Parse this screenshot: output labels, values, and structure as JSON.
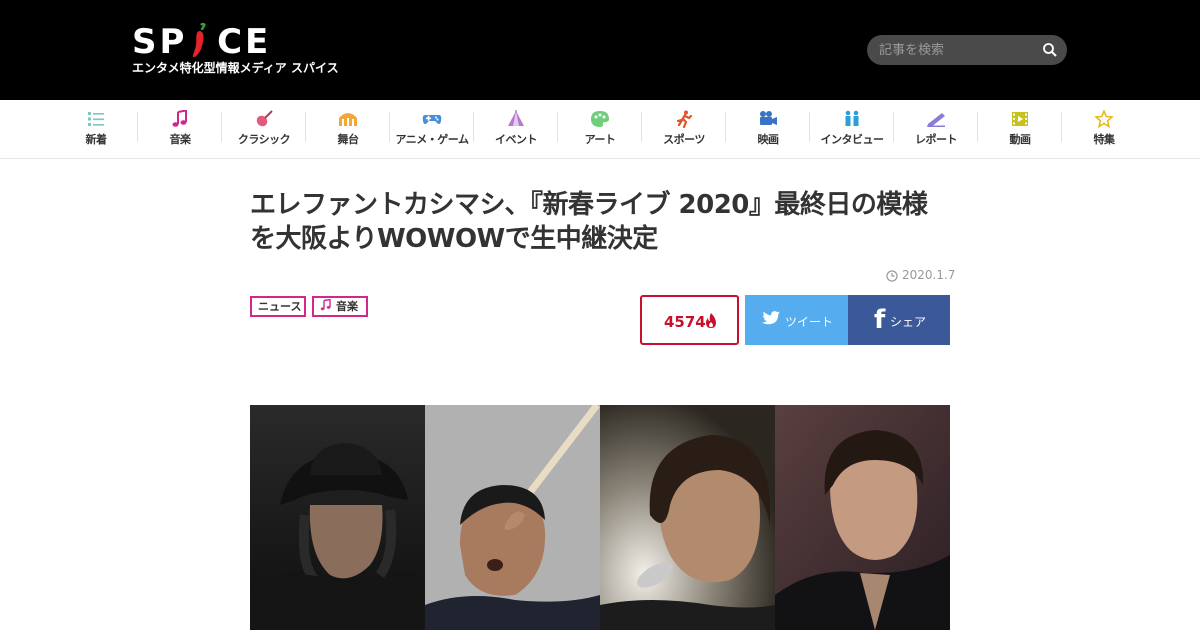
{
  "header": {
    "logo_text": "SPICE",
    "logo_tagline": "エンタメ特化型情報メディア スパイス",
    "search_placeholder": "記事を検索"
  },
  "nav": {
    "items": [
      {
        "label": "新着",
        "icon": "list-icon"
      },
      {
        "label": "音楽",
        "icon": "music-note-icon"
      },
      {
        "label": "クラシック",
        "icon": "violin-icon"
      },
      {
        "label": "舞台",
        "icon": "stage-icon"
      },
      {
        "label": "アニメ・ゲーム",
        "icon": "gamepad-icon"
      },
      {
        "label": "イベント",
        "icon": "tent-icon"
      },
      {
        "label": "アート",
        "icon": "palette-icon"
      },
      {
        "label": "スポーツ",
        "icon": "runner-icon"
      },
      {
        "label": "映画",
        "icon": "camera-icon"
      },
      {
        "label": "インタビュー",
        "icon": "interview-icon"
      },
      {
        "label": "レポート",
        "icon": "report-icon"
      },
      {
        "label": "動画",
        "icon": "film-icon"
      },
      {
        "label": "特集",
        "icon": "star-icon"
      }
    ]
  },
  "article": {
    "title": "エレファントカシマシ、『新春ライブ 2020』最終日の模様を大阪よりWOWOWで生中継決定",
    "date": "2020.1.7",
    "tags": [
      "ニュース",
      "音楽"
    ],
    "pv_count": "4574",
    "tweet_label": "ツイート",
    "share_label": "シェア"
  },
  "colors": {
    "header_bg": "#000000",
    "accent_pink": "#d3268a",
    "pv_red": "#c8102e",
    "twitter": "#55acee",
    "facebook": "#3b5998",
    "pepper_red": "#e3242b"
  }
}
